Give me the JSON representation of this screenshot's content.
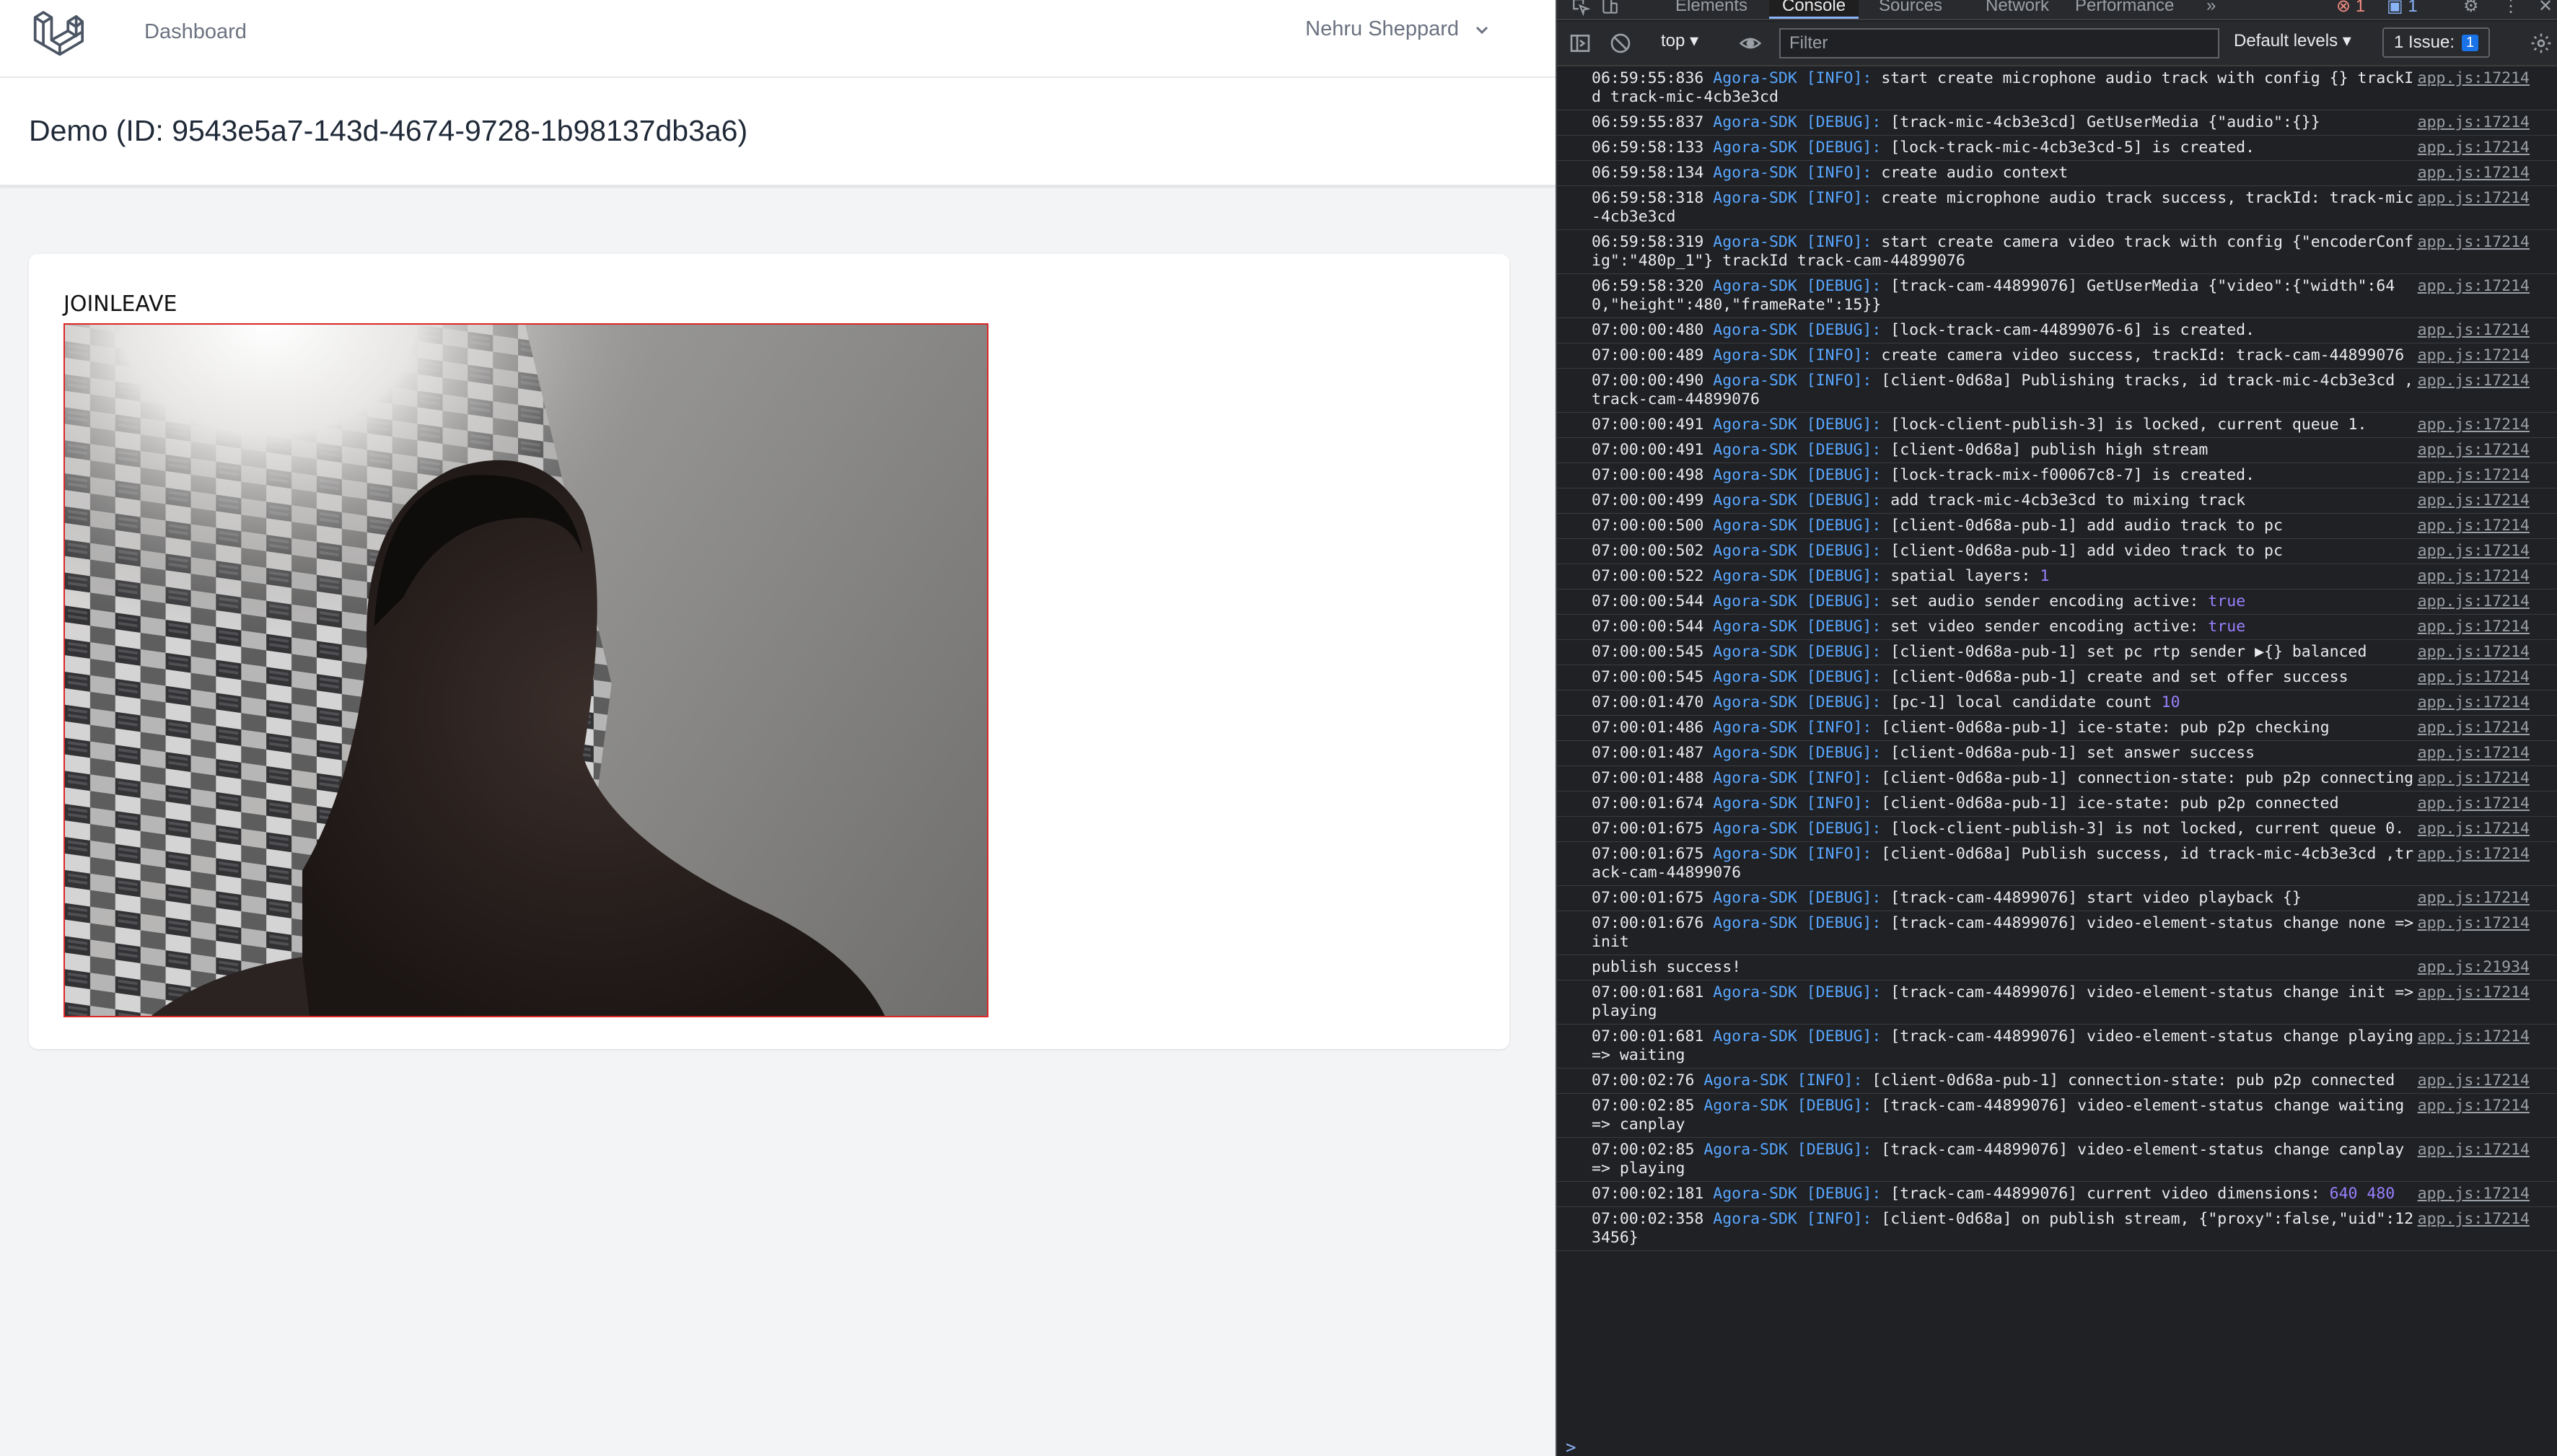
{
  "topnav": {
    "logo": "laravel-logo",
    "dashboard_link": "Dashboard",
    "user_name": "Nehru Sheppard"
  },
  "page": {
    "title": "Demo (ID: 9543e5a7-143d-4674-9728-1b98137db3a6)"
  },
  "controls": {
    "join_label": "JOIN",
    "leave_label": "LEAVE"
  },
  "devtools": {
    "tabs": [
      "Elements",
      "Console",
      "Sources",
      "Network",
      "Performance",
      "»"
    ],
    "active_tab": "Console",
    "context": "top",
    "filter_placeholder": "Filter",
    "levels": "Default levels",
    "issues_label": "1 Issue:",
    "issues_count": "1",
    "error_count": "1",
    "message_count": "1",
    "prompt": ">",
    "logs": [
      {
        "ts": "06:59:55:836",
        "sdk": "Agora-SDK [INFO]:",
        "msg": "start create microphone audio track with config {} trackId track-mic-4cb3e3cd",
        "src": "app.js:17214"
      },
      {
        "ts": "06:59:55:837",
        "sdk": "Agora-SDK [DEBUG]:",
        "msg": "[track-mic-4cb3e3cd] GetUserMedia {\"audio\":{}}",
        "src": "app.js:17214"
      },
      {
        "ts": "06:59:58:133",
        "sdk": "Agora-SDK [DEBUG]:",
        "msg": "[lock-track-mic-4cb3e3cd-5] is created.",
        "src": "app.js:17214"
      },
      {
        "ts": "06:59:58:134",
        "sdk": "Agora-SDK [INFO]:",
        "msg": "create audio context",
        "src": "app.js:17214"
      },
      {
        "ts": "06:59:58:318",
        "sdk": "Agora-SDK [INFO]:",
        "msg": "create microphone audio track success, trackId: track-mic-4cb3e3cd",
        "src": "app.js:17214"
      },
      {
        "ts": "06:59:58:319",
        "sdk": "Agora-SDK [INFO]:",
        "msg": "start create camera video track with config {\"encoderConfig\":\"480p_1\"} trackId track-cam-44899076",
        "src": "app.js:17214"
      },
      {
        "ts": "06:59:58:320",
        "sdk": "Agora-SDK [DEBUG]:",
        "msg": "[track-cam-44899076] GetUserMedia {\"video\":{\"width\":640,\"height\":480,\"frameRate\":15}}",
        "src": "app.js:17214"
      },
      {
        "ts": "07:00:00:480",
        "sdk": "Agora-SDK [DEBUG]:",
        "msg": "[lock-track-cam-44899076-6] is created.",
        "src": "app.js:17214"
      },
      {
        "ts": "07:00:00:489",
        "sdk": "Agora-SDK [INFO]:",
        "msg": "create camera video success, trackId: track-cam-44899076",
        "src": "app.js:17214"
      },
      {
        "ts": "07:00:00:490",
        "sdk": "Agora-SDK [INFO]:",
        "msg": "[client-0d68a] Publishing tracks, id track-mic-4cb3e3cd ,track-cam-44899076",
        "src": "app.js:17214"
      },
      {
        "ts": "07:00:00:491",
        "sdk": "Agora-SDK [DEBUG]:",
        "msg": "[lock-client-publish-3] is locked, current queue 1.",
        "src": "app.js:17214"
      },
      {
        "ts": "07:00:00:491",
        "sdk": "Agora-SDK [DEBUG]:",
        "msg": "[client-0d68a] publish high stream",
        "src": "app.js:17214"
      },
      {
        "ts": "07:00:00:498",
        "sdk": "Agora-SDK [DEBUG]:",
        "msg": "[lock-track-mix-f00067c8-7] is created.",
        "src": "app.js:17214"
      },
      {
        "ts": "07:00:00:499",
        "sdk": "Agora-SDK [DEBUG]:",
        "msg": "add track-mic-4cb3e3cd to mixing track",
        "src": "app.js:17214"
      },
      {
        "ts": "07:00:00:500",
        "sdk": "Agora-SDK [DEBUG]:",
        "msg": "[client-0d68a-pub-1] add audio track to pc",
        "src": "app.js:17214"
      },
      {
        "ts": "07:00:00:502",
        "sdk": "Agora-SDK [DEBUG]:",
        "msg": "[client-0d68a-pub-1] add video track to pc",
        "src": "app.js:17214"
      },
      {
        "ts": "07:00:00:522",
        "sdk": "Agora-SDK [DEBUG]:",
        "msg": "spatial layers: ",
        "tail": "1",
        "src": "app.js:17214"
      },
      {
        "ts": "07:00:00:544",
        "sdk": "Agora-SDK [DEBUG]:",
        "msg": "set audio sender encoding active: ",
        "tail": "true",
        "src": "app.js:17214"
      },
      {
        "ts": "07:00:00:544",
        "sdk": "Agora-SDK [DEBUG]:",
        "msg": "set video sender encoding active: ",
        "tail": "true",
        "src": "app.js:17214"
      },
      {
        "ts": "07:00:00:545",
        "sdk": "Agora-SDK [DEBUG]:",
        "msg": "[client-0d68a-pub-1] set pc rtp sender ▶{} balanced",
        "src": "app.js:17214"
      },
      {
        "ts": "07:00:00:545",
        "sdk": "Agora-SDK [DEBUG]:",
        "msg": "[client-0d68a-pub-1] create and set offer success",
        "src": "app.js:17214"
      },
      {
        "ts": "07:00:01:470",
        "sdk": "Agora-SDK [DEBUG]:",
        "msg": "[pc-1] local candidate count ",
        "tail": "10",
        "src": "app.js:17214"
      },
      {
        "ts": "07:00:01:486",
        "sdk": "Agora-SDK [INFO]:",
        "msg": "[client-0d68a-pub-1] ice-state: pub p2p checking",
        "src": "app.js:17214"
      },
      {
        "ts": "07:00:01:487",
        "sdk": "Agora-SDK [DEBUG]:",
        "msg": "[client-0d68a-pub-1] set answer success",
        "src": "app.js:17214"
      },
      {
        "ts": "07:00:01:488",
        "sdk": "Agora-SDK [INFO]:",
        "msg": "[client-0d68a-pub-1] connection-state: pub p2p connecting",
        "src": "app.js:17214"
      },
      {
        "ts": "07:00:01:674",
        "sdk": "Agora-SDK [INFO]:",
        "msg": "[client-0d68a-pub-1] ice-state: pub p2p connected",
        "src": "app.js:17214"
      },
      {
        "ts": "07:00:01:675",
        "sdk": "Agora-SDK [DEBUG]:",
        "msg": "[lock-client-publish-3] is not locked, current queue 0.",
        "src": "app.js:17214"
      },
      {
        "ts": "07:00:01:675",
        "sdk": "Agora-SDK [INFO]:",
        "msg": "[client-0d68a] Publish success, id track-mic-4cb3e3cd ,track-cam-44899076",
        "src": "app.js:17214"
      },
      {
        "ts": "07:00:01:675",
        "sdk": "Agora-SDK [DEBUG]:",
        "msg": "[track-cam-44899076] start video playback {}",
        "src": "app.js:17214"
      },
      {
        "ts": "07:00:01:676",
        "sdk": "Agora-SDK [DEBUG]:",
        "msg": "[track-cam-44899076] video-element-status change none => init",
        "src": "app.js:17214"
      },
      {
        "ts": "",
        "sdk": "",
        "msg": "publish success!",
        "src": "app.js:21934"
      },
      {
        "ts": "07:00:01:681",
        "sdk": "Agora-SDK [DEBUG]:",
        "msg": "[track-cam-44899076] video-element-status change init => playing",
        "src": "app.js:17214"
      },
      {
        "ts": "07:00:01:681",
        "sdk": "Agora-SDK [DEBUG]:",
        "msg": "[track-cam-44899076] video-element-status change playing => waiting",
        "src": "app.js:17214"
      },
      {
        "ts": "07:00:02:76",
        "sdk": "Agora-SDK [INFO]:",
        "msg": "[client-0d68a-pub-1] connection-state: pub p2p connected",
        "src": "app.js:17214"
      },
      {
        "ts": "07:00:02:85",
        "sdk": "Agora-SDK [DEBUG]:",
        "msg": "[track-cam-44899076] video-element-status change waiting => canplay",
        "src": "app.js:17214"
      },
      {
        "ts": "07:00:02:85",
        "sdk": "Agora-SDK [DEBUG]:",
        "msg": "[track-cam-44899076] video-element-status change canplay => playing",
        "src": "app.js:17214"
      },
      {
        "ts": "07:00:02:181",
        "sdk": "Agora-SDK [DEBUG]:",
        "msg": "[track-cam-44899076] current video dimensions: ",
        "tail": "640 480",
        "src": "app.js:17214"
      },
      {
        "ts": "07:00:02:358",
        "sdk": "Agora-SDK [INFO]:",
        "msg": "[client-0d68a] on publish stream, {\"proxy\":false,\"uid\":123456}",
        "src": "app.js:17214"
      }
    ]
  }
}
